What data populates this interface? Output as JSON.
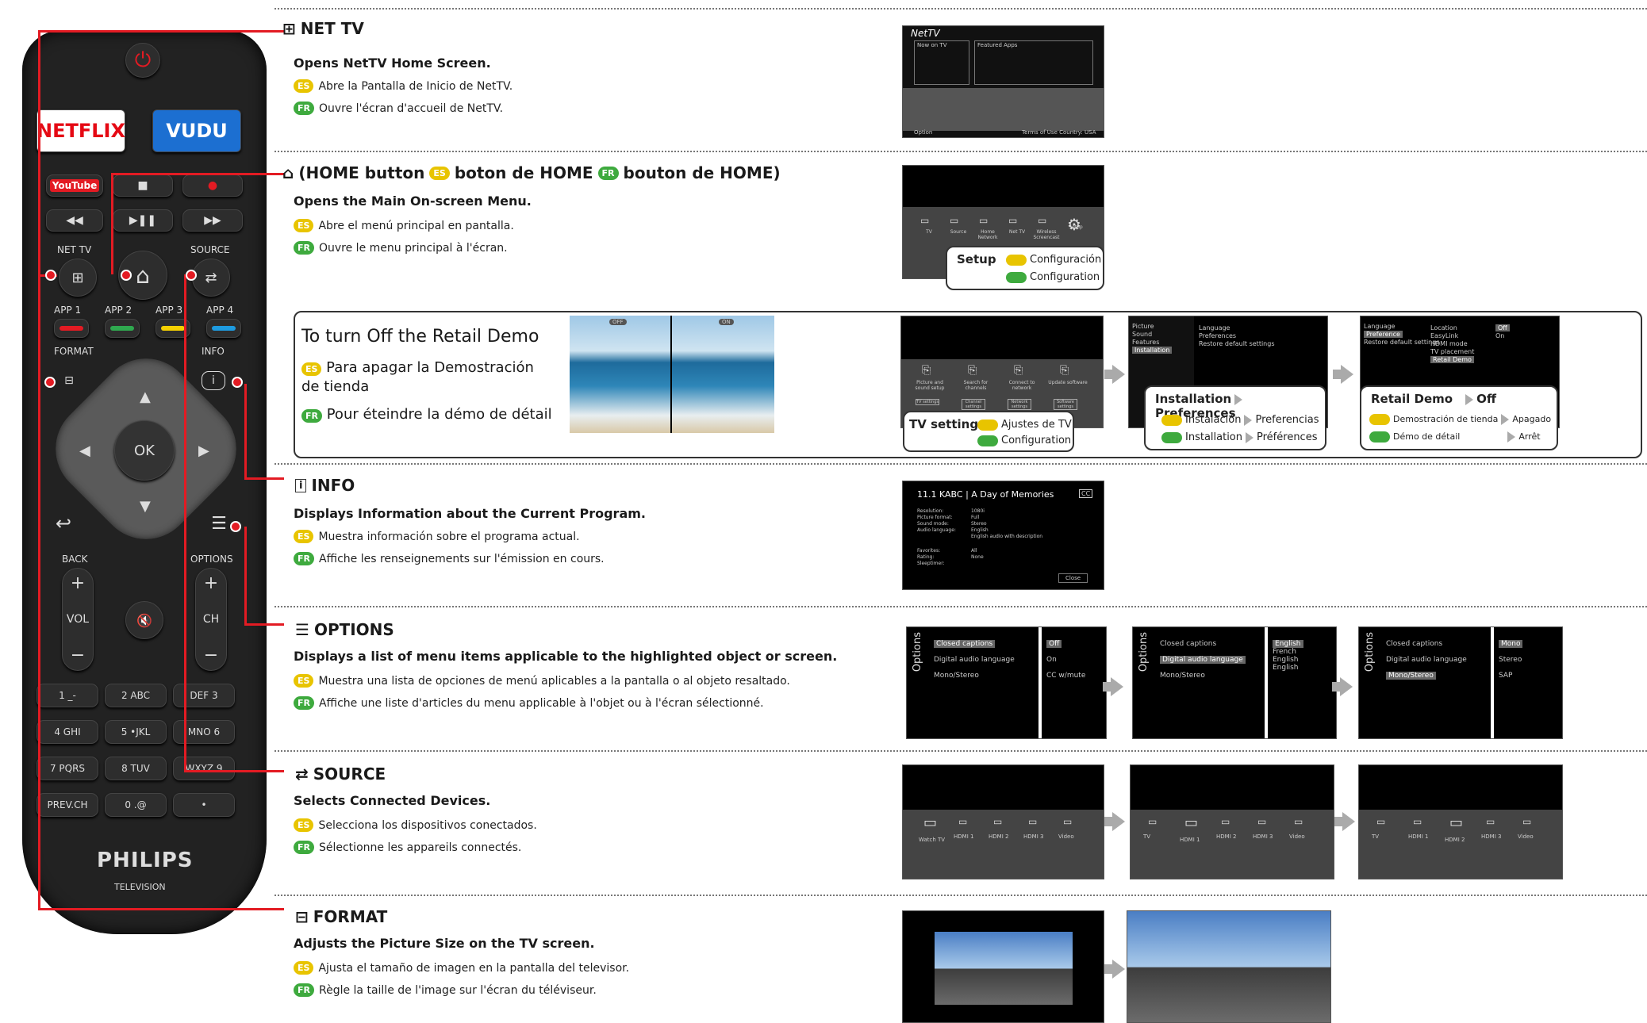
{
  "remote": {
    "netflix": "NETFLIX",
    "vudu": "VUDU",
    "youtube": "YouTube",
    "net_tv_label": "NET TV",
    "source_label": "SOURCE",
    "app1": "APP 1",
    "app2": "APP 2",
    "app3": "APP 3",
    "app4": "APP 4",
    "format_label": "FORMAT",
    "info_label": "INFO",
    "ok": "OK",
    "back_label": "BACK",
    "options_label": "OPTIONS",
    "vol": "VOL",
    "ch": "CH",
    "keys": [
      "1 _-",
      "2 ABC",
      "DEF 3",
      "4 GHI",
      "5 •JKL",
      "MNO 6",
      "7 PQRS",
      "8 TUV",
      "WXYZ 9",
      "PREV.CH",
      "0 .@",
      "•"
    ],
    "brand": "PHILIPS",
    "brand_sub": "TELEVISION",
    "colors": {
      "red": "#e31b23",
      "green": "#2fa84f",
      "yellow": "#f5d000",
      "blue": "#1e9be0",
      "netflix": "#e50914",
      "vudu": "#1c6fd1"
    }
  },
  "sections": {
    "nettv": {
      "title": "NET TV",
      "desc": "Opens NetTV Home Screen.",
      "es": "Abre la Pantalla de Inicio de NetTV.",
      "fr": "Ouvre l'écran d'accueil de NetTV."
    },
    "home": {
      "title": "(HOME button",
      "es_title": "boton de HOME",
      "fr_title": "bouton de HOME)",
      "desc": "Opens the Main On-screen Menu.",
      "es": "Abre el menú principal en pantalla.",
      "fr": "Ouvre le menu principal à l'écran."
    },
    "retail": {
      "title": "To turn Off the Retail Demo",
      "es": "Para apagar la Demostración de tienda",
      "fr": "Pour éteindre la démo de détail"
    },
    "info": {
      "title": "INFO",
      "desc": "Displays Information about the Current Program.",
      "es": "Muestra información sobre el programa actual.",
      "fr": "Affiche les renseignements sur l'émission en cours."
    },
    "options": {
      "title": "OPTIONS",
      "desc": "Displays a list of menu items applicable to the highlighted object or screen.",
      "es": "Muestra una lista de opciones de menú aplicables a la pantalla o al objeto resaltado.",
      "fr": "Affiche une liste d'articles du menu applicable à l'objet ou à l'écran sélectionné."
    },
    "source": {
      "title": "SOURCE",
      "desc": "Selects Connected Devices.",
      "es": "Selecciona los dispositivos conectados.",
      "fr": "Sélectionne les appareils connectés."
    },
    "format": {
      "title": "FORMAT",
      "desc": "Adjusts the Picture Size on the TV screen.",
      "es": "Ajusta el tamaño de imagen en la pantalla del televisor.",
      "fr": "Règle la taille de l'image sur l'écran du téléviseur."
    }
  },
  "badges": {
    "es": "ES",
    "fr": "FR"
  },
  "screens": {
    "nettv": {
      "logo": "NetTV",
      "now_on": "Now on TV",
      "featured": "Featured Apps",
      "option": "Option",
      "footer": "Terms of Use  Country: USA"
    },
    "home_menu": [
      "TV",
      "Source",
      "Home Network",
      "Net TV",
      "Wireless Screencast",
      "Setup"
    ],
    "setup_callout": {
      "title": "Setup",
      "es": "Configuración",
      "fr": "Configuration"
    },
    "demo_off": "OFF",
    "demo_on": "ON",
    "tv_settings_icons": [
      "Picture and sound setup",
      "Search for channels",
      "Connect to network",
      "Update software"
    ],
    "tv_settings_btns": [
      "TV settings",
      "Channel settings",
      "Network settings",
      "Software settings"
    ],
    "tv_settings_callout": {
      "title": "TV settings",
      "es": "Ajustes de TV",
      "fr": "Configuration"
    },
    "install_menu_left": [
      "Picture",
      "Sound",
      "Features",
      "Installation"
    ],
    "install_menu_right": [
      "Language",
      "Preferences",
      "Restore default settings"
    ],
    "install_callout": {
      "a": "Installation",
      "b": "Preferences",
      "es_a": "Instalación",
      "es_b": "Preferencias",
      "fr_a": "Installation",
      "fr_b": "Préférences"
    },
    "retail_menu_left": [
      "Language",
      "Preference",
      "Restore default settings"
    ],
    "retail_menu_mid": [
      "Location",
      "EasyLink",
      "HDMI mode",
      "TV placement",
      "Retail Demo"
    ],
    "retail_menu_right": [
      "Off",
      "On"
    ],
    "retail_callout": {
      "a": "Retail Demo",
      "b": "Off",
      "es_a": "Demostración de tienda",
      "es_b": "Apagado",
      "fr_a": "Démo de détail",
      "fr_b": "Arrêt"
    },
    "info_box": {
      "title": "11.1 KABC | A Day of Memories",
      "cc": "CC",
      "rows": [
        [
          "Resolution:",
          "1080i"
        ],
        [
          "Picture format:",
          "Full"
        ],
        [
          "Sound mode:",
          "Stereo"
        ],
        [
          "Audio language:",
          "English"
        ],
        [
          "",
          "English audio with description"
        ],
        [
          "Favorites:",
          "All"
        ],
        [
          "Rating:",
          "None"
        ],
        [
          "Sleeptimer:",
          ""
        ]
      ],
      "close": "Close"
    },
    "options_label": "Options",
    "options_items": [
      "Closed captions",
      "Digital audio language",
      "Mono/Stereo"
    ],
    "opt1_right": [
      "Off",
      "On",
      "CC w/mute"
    ],
    "opt2_right": [
      "English",
      "French",
      "English",
      "English"
    ],
    "opt3_right": [
      "Mono",
      "Stereo",
      "SAP"
    ],
    "source1": [
      "Watch TV",
      "HDMI 1",
      "HDMI 2",
      "HDMI 3",
      "Video"
    ],
    "source2": [
      "TV",
      "HDMI 1",
      "HDMI 2",
      "HDMI 3",
      "Video"
    ],
    "source3": [
      "TV",
      "HDMI 1",
      "HDMI 2",
      "HDMI 3",
      "Video"
    ]
  }
}
